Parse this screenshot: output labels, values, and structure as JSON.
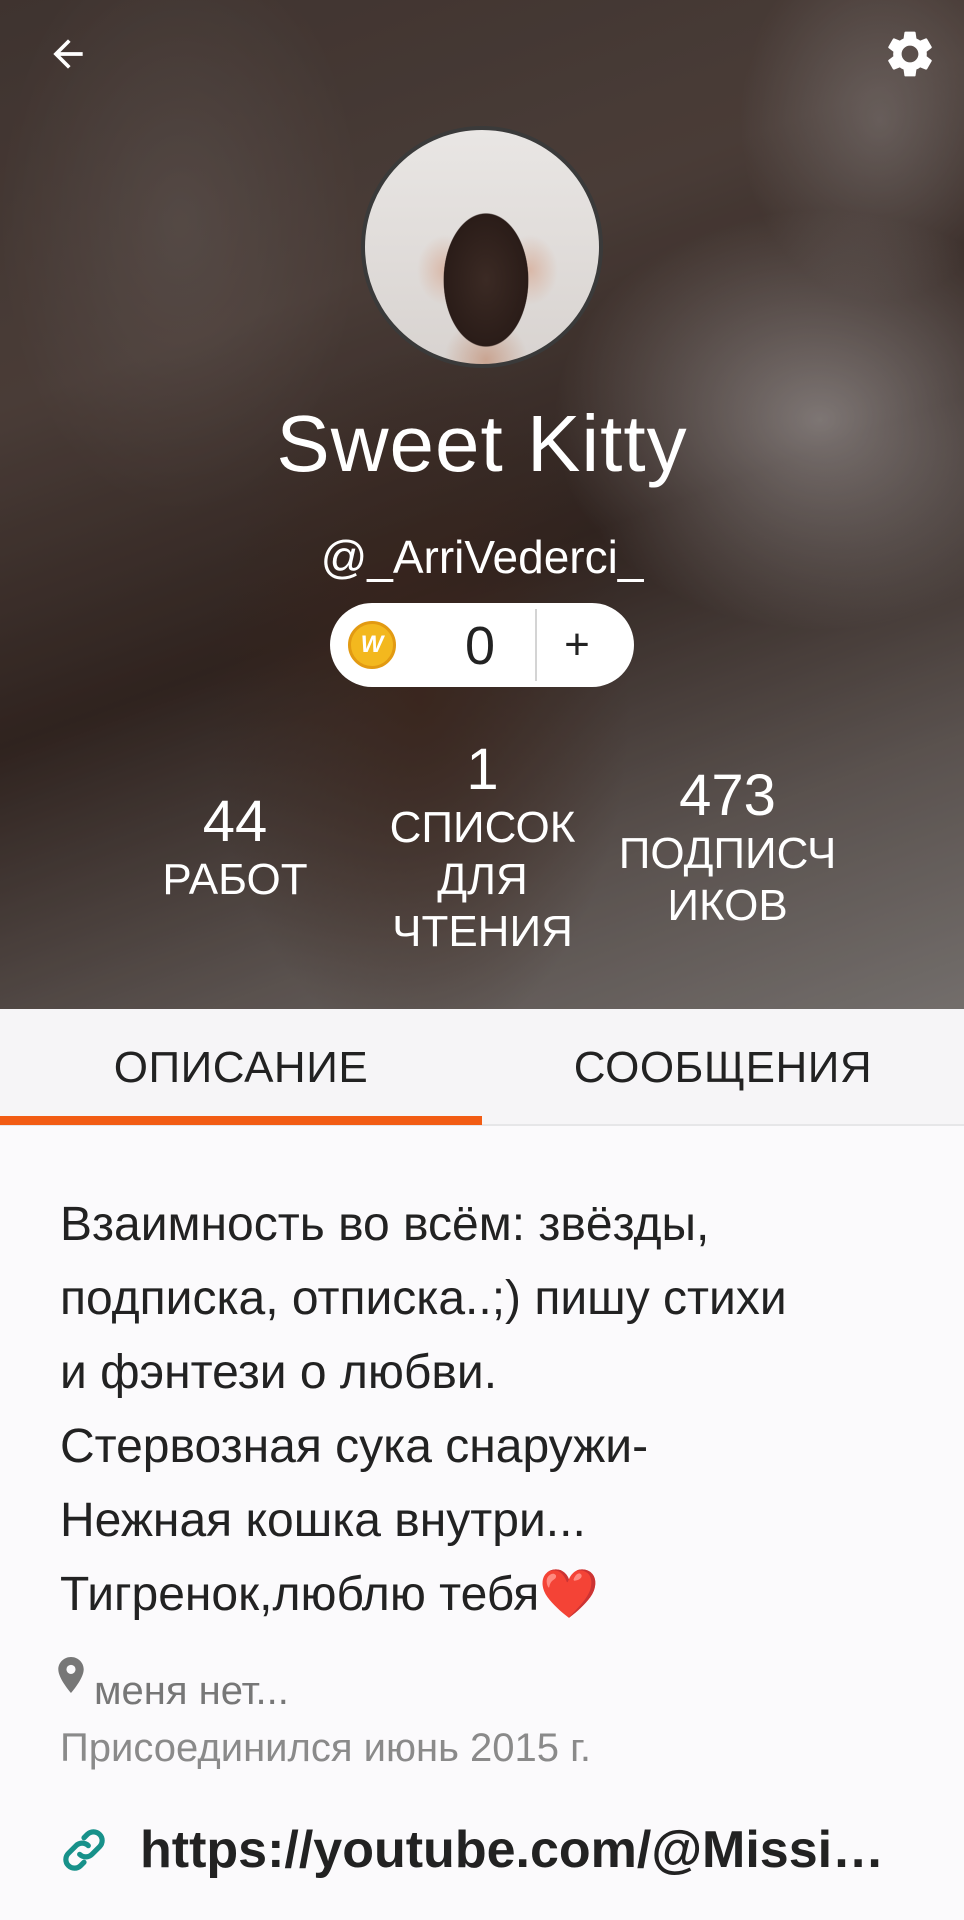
{
  "header": {
    "back_icon": "arrow-left-icon",
    "settings_icon": "gear-icon",
    "display_name": "Sweet Kitty",
    "username": "@_ArriVederci_",
    "coins": {
      "value": "0",
      "add_label": "+",
      "coin_letter": "W"
    }
  },
  "stats": [
    {
      "value": "44",
      "label": "РАБОТ"
    },
    {
      "value": "1",
      "label_lines": [
        "СПИСОК",
        "ДЛЯ",
        "ЧТЕНИЯ"
      ]
    },
    {
      "value": "473",
      "label_lines": [
        "ПОДПИСЧ",
        "ИКОВ"
      ]
    }
  ],
  "tabs": {
    "description": "ОПИСАНИЕ",
    "messages": "СООБЩЕНИЯ",
    "active": "description",
    "accent_color": "#f25c14"
  },
  "about": {
    "lines": [
      "Взаимность во всём: звёзды,",
      "подписка, отписка..;) пишу стихи",
      "и фэнтези о любви.",
      "Стервозная сука снаружи-",
      "Нежная кошка внутри...",
      "Тигренок,люблю тебя"
    ],
    "heart": "❤️",
    "location": "меня нет...",
    "joined": "Присоединился июнь 2015 г.",
    "link": "https://youtube.com/@Missis_..."
  }
}
